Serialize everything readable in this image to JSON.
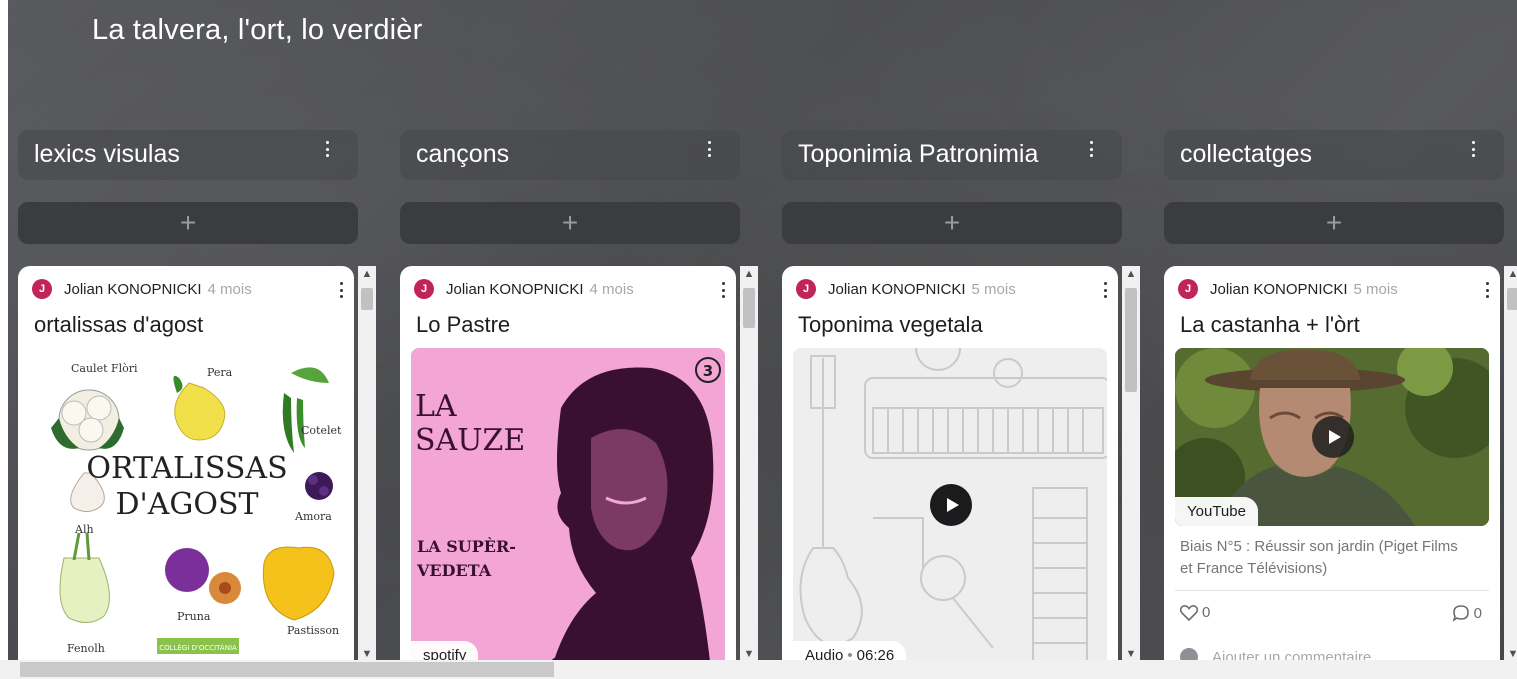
{
  "board": {
    "title": "La talvera, l'ort, lo verdièr"
  },
  "columns": [
    {
      "title": "lexics visulas",
      "add_label": "+",
      "card": {
        "avatar_initial": "J",
        "author": "Jolian KONOPNICKI",
        "age": "4 mois",
        "title": "ortalissas d'agost",
        "image": {
          "heading_line1": "ORTALISSAS",
          "heading_line2": "D'AGOST",
          "labels": [
            "Caulet Flòri",
            "Pera",
            "Cotelet",
            "Alh",
            "Amora",
            "Pruna",
            "Fenolh",
            "Pastisson"
          ],
          "footer": "COLLÈGI D'OCCITÀNIA"
        }
      }
    },
    {
      "title": "cançons",
      "add_label": "+",
      "card": {
        "avatar_initial": "J",
        "author": "Jolian KONOPNICKI",
        "age": "4 mois",
        "title": "Lo Pastre",
        "image": {
          "line1": "LA",
          "line2": "SAUZE",
          "line3": "LA SUPÈR-",
          "line4": "VEDETA",
          "number": "3"
        },
        "source": "spotify"
      }
    },
    {
      "title": "Toponimia Patronimia",
      "add_label": "+",
      "card": {
        "avatar_initial": "J",
        "author": "Jolian KONOPNICKI",
        "age": "5 mois",
        "title": "Toponima vegetala",
        "media_type": "Audio",
        "duration": "06:26"
      }
    },
    {
      "title": "collectatges",
      "add_label": "+",
      "card": {
        "avatar_initial": "J",
        "author": "Jolian KONOPNICKI",
        "age": "5 mois",
        "title": "La castanha + l'òrt",
        "source": "YouTube",
        "description": "Biais N°5 : Réussir son jardin (Piget Films et France Télévisions)",
        "likes": "0",
        "comments": "0",
        "add_comment_placeholder": "Ajouter un commentaire"
      }
    }
  ],
  "colors": {
    "background": "#4e4f51",
    "avatar": "#c0245a",
    "cancons_cover": "#f3a6d6"
  }
}
